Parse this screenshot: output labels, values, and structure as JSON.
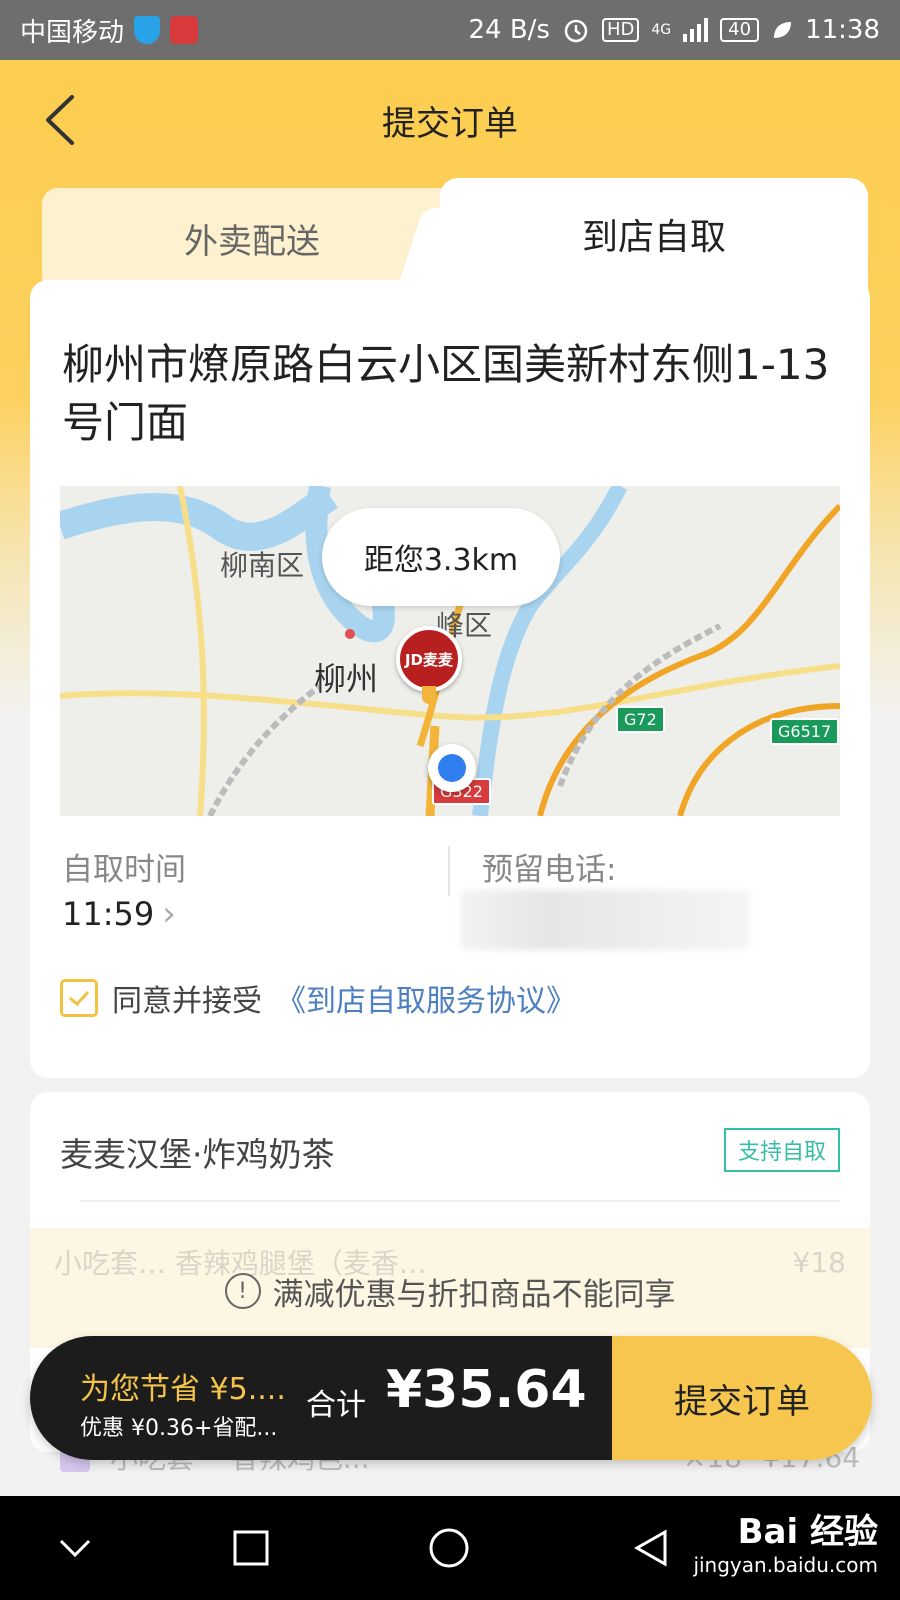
{
  "status_bar": {
    "carrier": "中国移动",
    "speed": "24 B/s",
    "hd": "HD",
    "network": "4G",
    "battery": "40",
    "time": "11:38"
  },
  "header": {
    "title": "提交订单"
  },
  "tabs": [
    {
      "label": "外卖配送",
      "active": false
    },
    {
      "label": "到店自取",
      "active": true
    }
  ],
  "pickup": {
    "address": "柳州市燎原路白云小区国美新村东侧1-13号门面",
    "map": {
      "distance_bubble": "距您3.3km",
      "labels": [
        "柳南区",
        "柳州",
        "峰区"
      ],
      "road_badges": [
        "G72",
        "G6517",
        "G322"
      ],
      "shop_pin_text": "JD麦麦"
    },
    "time_label": "自取时间",
    "time_value": "11:59",
    "phone_label": "预留电话:",
    "agree_text": "同意并接受",
    "agree_link": "《到店自取服务协议》",
    "agree_checked": true
  },
  "shop": {
    "name": "麦麦汉堡·炸鸡奶茶",
    "tag": "支持自取",
    "item_faded": {
      "name": "小吃套…  香辣鸡腿堡（麦香…",
      "price": "¥18"
    }
  },
  "notice": {
    "text": "满减优惠与折扣商品不能同享"
  },
  "bottom_item_faded": {
    "name": "小吃套一 香辣鸡色...",
    "qty": "×18",
    "price": "¥17.64"
  },
  "checkout": {
    "save_text": "为您节省 ¥5....",
    "discount_text": "优惠 ¥0.36+省配...",
    "total_label": "合计",
    "total_amount": "¥35.64",
    "submit_label": "提交订单"
  },
  "watermark": {
    "main": "Bai 经验",
    "sub": "jingyan.baidu.com"
  },
  "colors": {
    "brand_yellow": "#fccc4c",
    "button_yellow": "#f6c64e",
    "tag_teal": "#36bda7",
    "link_blue": "#4e7fc2"
  }
}
